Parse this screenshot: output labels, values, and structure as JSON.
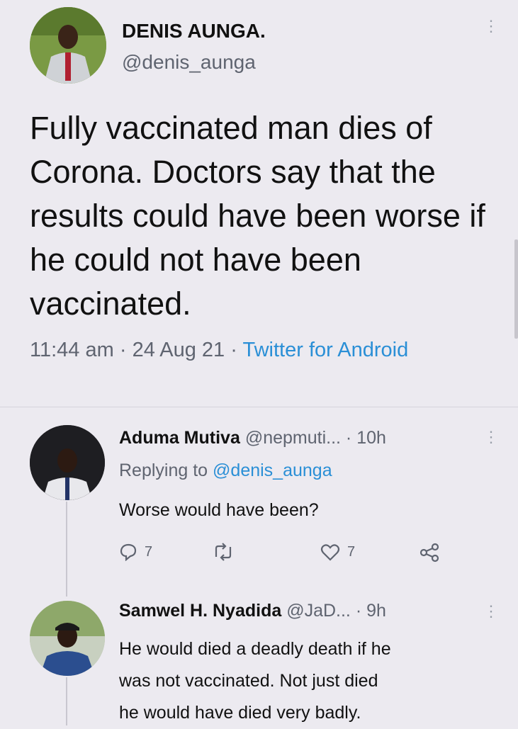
{
  "tweet": {
    "author_name": "DENIS AUNGA.",
    "author_handle": "@denis_aunga",
    "text": "Fully vaccinated man dies of Corona. Doctors say that the results could have been worse if he could not have been vaccinated.",
    "time": "11:44 am",
    "date": "24 Aug 21",
    "source": "Twitter for Android",
    "separator": "·"
  },
  "replies": [
    {
      "name": "Aduma Mutiva",
      "handle": "@nepmuti...",
      "age": "· 10h",
      "replying_prefix": "Replying to",
      "replying_to": "@denis_aunga",
      "text": "Worse would have been?",
      "reply_count": "7",
      "retweet_count": "",
      "like_count": "7"
    },
    {
      "name": "Samwel H. Nyadida",
      "handle": "@JaD...",
      "age": "· 9h",
      "text_lines": [
        "He would died a deadly death if he",
        "was not vaccinated. Not just died",
        "he would have died very badly."
      ]
    }
  ],
  "icons": {
    "more": "more-vertical-icon",
    "reply": "reply-icon",
    "retweet": "retweet-icon",
    "like": "heart-icon",
    "share": "share-icon"
  },
  "colors": {
    "background": "#eceaf0",
    "link": "#2a8fd6",
    "muted": "#5f6470"
  }
}
